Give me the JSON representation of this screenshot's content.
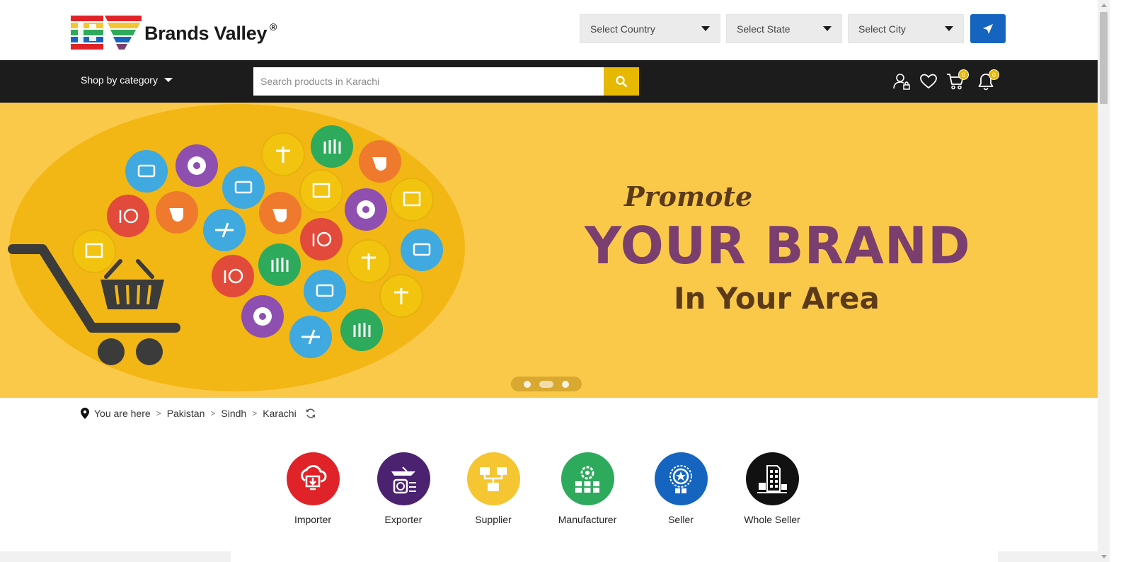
{
  "header": {
    "brand_name": "Brands Valley",
    "brand_mark": "BV",
    "registered_symbol": "®",
    "country_select": "Select Country",
    "state_select": "Select State",
    "city_select": "Select City",
    "locate_icon": "location-arrow-icon"
  },
  "navbar": {
    "shop_by_category": "Shop by category",
    "search_placeholder": "Search products in Karachi",
    "search_icon": "search-icon",
    "account_icon": "user-lock-icon",
    "wishlist_icon": "heart-icon",
    "cart_icon": "cart-icon",
    "cart_count": "0",
    "notification_icon": "bell-icon",
    "notification_count": "0"
  },
  "hero": {
    "promote": "Promote",
    "headline": "YOUR BRAND",
    "subline": "In Your Area",
    "slides": 3,
    "active_slide": 2
  },
  "breadcrumb": {
    "you_are_here": "You are here",
    "separator": ">",
    "items": [
      "Pakistan",
      "Sindh",
      "Karachi"
    ],
    "refresh_icon": "refresh-icon"
  },
  "categories": [
    {
      "label": "Importer",
      "icon": "cloud-download-icon",
      "color": "#e02328"
    },
    {
      "label": "Exporter",
      "icon": "airplane-globe-icon",
      "color": "#4a2270"
    },
    {
      "label": "Supplier",
      "icon": "distribution-boxes-icon",
      "color": "#f5c532"
    },
    {
      "label": "Manufacturer",
      "icon": "factory-gear-icon",
      "color": "#2eaa5c"
    },
    {
      "label": "Seller",
      "icon": "award-badge-icon",
      "color": "#1565c0"
    },
    {
      "label": "Whole Seller",
      "icon": "warehouse-truck-icon",
      "color": "#111111"
    }
  ],
  "colors": {
    "nav_bg": "#1c1c1c",
    "accent_yellow": "#e6b800",
    "accent_blue": "#1565c0",
    "hero_bg": "#fbc94a",
    "headline_purple": "#7a3f6e",
    "text_brown": "#5b3a1a"
  }
}
